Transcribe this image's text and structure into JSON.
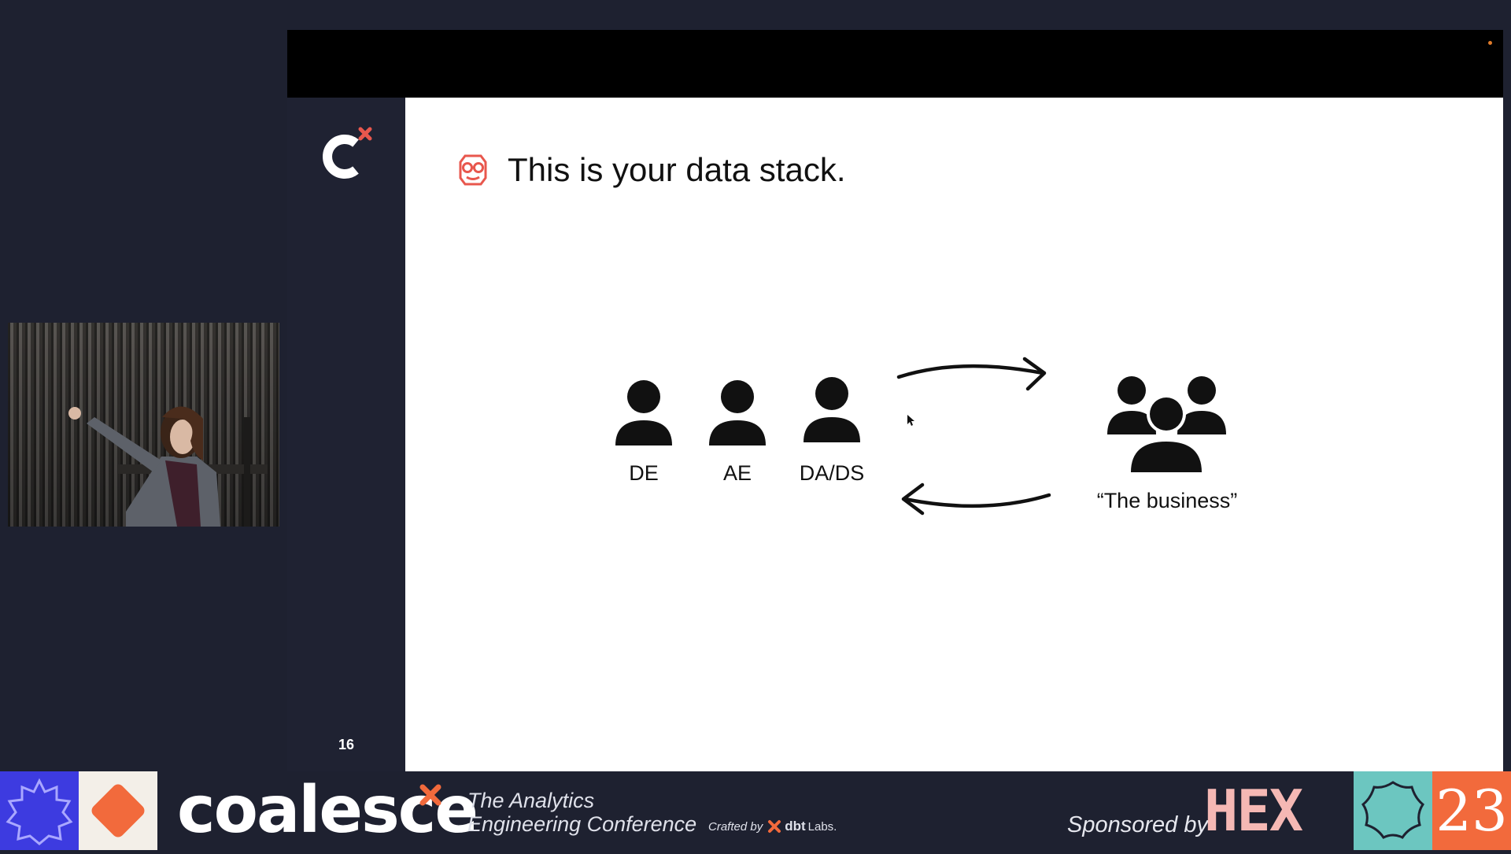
{
  "slide": {
    "title": "This is your data stack.",
    "number": "16",
    "roles": [
      {
        "label": "DE"
      },
      {
        "label": "AE"
      },
      {
        "label": "DA/DS"
      }
    ],
    "group_label": "“The business”",
    "accent_color": "#e8574d",
    "icons": {
      "title_icon": "nerd-face-icon",
      "person": "person-icon",
      "group": "people-group-icon",
      "arrows": "bidirectional-arrows-icon",
      "logo": "coalesce-c-logo"
    }
  },
  "banner": {
    "brand": "coalesce",
    "tagline_line1": "The Analytics",
    "tagline_line2": "Engineering Conference",
    "crafted_by": "Crafted by",
    "crafted_company": "dbt",
    "crafted_company_suffix": "Labs.",
    "sponsored_by": "Sponsored by",
    "sponsor": "HEX",
    "year": "23",
    "colors": {
      "purple": "#3d3be0",
      "orange": "#f26a3c",
      "teal": "#6cc6c0",
      "cream": "#f3efe8",
      "sponsor_pink": "#f5b8b4"
    }
  }
}
